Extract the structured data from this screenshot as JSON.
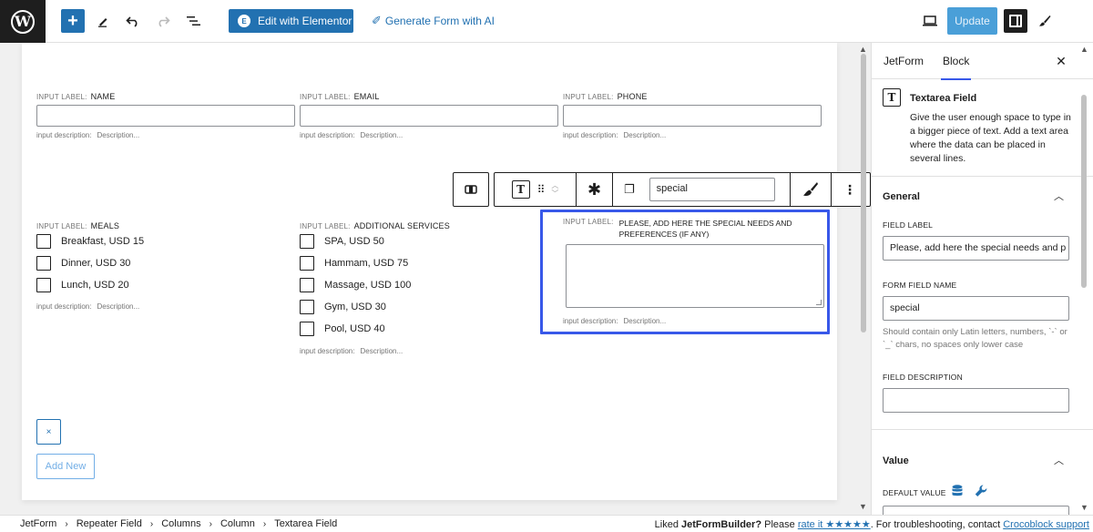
{
  "topbar": {
    "logo": "W",
    "elementor_label": "Edit with Elementor",
    "ai_label": "Generate Form with AI",
    "update_label": "Update"
  },
  "form": {
    "row1": [
      {
        "prefix": "INPUT LABEL:",
        "label": "NAME"
      },
      {
        "prefix": "INPUT LABEL:",
        "label": "EMAIL"
      },
      {
        "prefix": "INPUT LABEL:",
        "label": "PHONE"
      }
    ],
    "desc_prefix": "input description:",
    "desc_placeholder": "Description...",
    "meals": {
      "prefix": "INPUT LABEL:",
      "label": "MEALS",
      "options": [
        "Breakfast, USD 15",
        "Dinner, USD 30",
        "Lunch, USD 20"
      ]
    },
    "services": {
      "prefix": "INPUT LABEL:",
      "label": "ADDITIONAL SERVICES",
      "options": [
        "SPA, USD 50",
        "Hammam, USD 75",
        "Massage, USD 100",
        "Gym, USD 30",
        "Pool, USD 40"
      ]
    },
    "special": {
      "prefix": "INPUT LABEL:",
      "label_line1": "PLEASE, ADD HERE THE SPECIAL NEEDS AND",
      "label_line2": "PREFERENCES (IF ANY)"
    },
    "remove_label": "×",
    "add_new_label": "Add New"
  },
  "block_toolbar": {
    "name_value": "special"
  },
  "sidebar": {
    "tabs": [
      "JetForm",
      "Block"
    ],
    "block_icon": "T",
    "block_title": "Textarea Field",
    "block_desc": "Give the user enough space to type in a bigger piece of text. Add a text area where the data can be placed in several lines.",
    "general_title": "General",
    "field_label_label": "FIELD LABEL",
    "field_label_value": "Please, add here the special needs and p",
    "form_field_name_label": "FORM FIELD NAME",
    "form_field_name_value": "special",
    "form_field_name_help": "Should contain only Latin letters, numbers, `-` or `_` chars, no spaces only lower case",
    "field_desc_label": "FIELD DESCRIPTION",
    "field_desc_value": "",
    "value_title": "Value",
    "default_value_label": "DEFAULT VALUE"
  },
  "footer": {
    "crumbs": [
      "JetForm",
      "Repeater Field",
      "Columns",
      "Column",
      "Textarea Field"
    ],
    "liked_text": "Liked",
    "liked_brand": "JetFormBuilder?",
    "please": "Please",
    "rate_link": "rate it ★★★★★",
    "trouble_text": ". For troubleshooting, contact",
    "support_link": "Crocoblock support"
  }
}
